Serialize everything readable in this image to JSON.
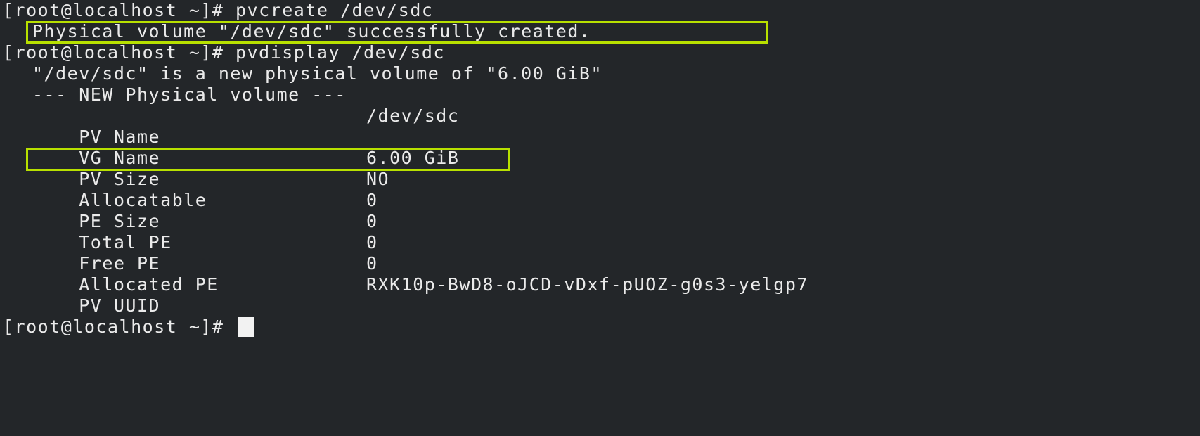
{
  "terminal": {
    "prompt": "[root@localhost ~]#",
    "cmd1": "pvcreate /dev/sdc",
    "cmd1_output": "Physical volume \"/dev/sdc\" successfully created.",
    "cmd2": "pvdisplay /dev/sdc",
    "intro": "\"/dev/sdc\" is a new physical volume of \"6.00 GiB\"",
    "section_header": "--- NEW Physical volume ---",
    "fields": [
      {
        "label": "PV Name",
        "value": "/dev/sdc"
      },
      {
        "label": "VG Name",
        "value": ""
      },
      {
        "label": "PV Size",
        "value": "6.00 GiB"
      },
      {
        "label": "Allocatable",
        "value": "NO"
      },
      {
        "label": "PE Size",
        "value": "0"
      },
      {
        "label": "Total PE",
        "value": "0"
      },
      {
        "label": "Free PE",
        "value": "0"
      },
      {
        "label": "Allocated PE",
        "value": "0"
      },
      {
        "label": "PV UUID",
        "value": "RXK10p-BwD8-oJCD-vDxf-pUOZ-g0s3-yelgp7"
      }
    ]
  },
  "colors": {
    "background": "#232629",
    "text": "#eaeaea",
    "highlight": "#b8e000"
  }
}
